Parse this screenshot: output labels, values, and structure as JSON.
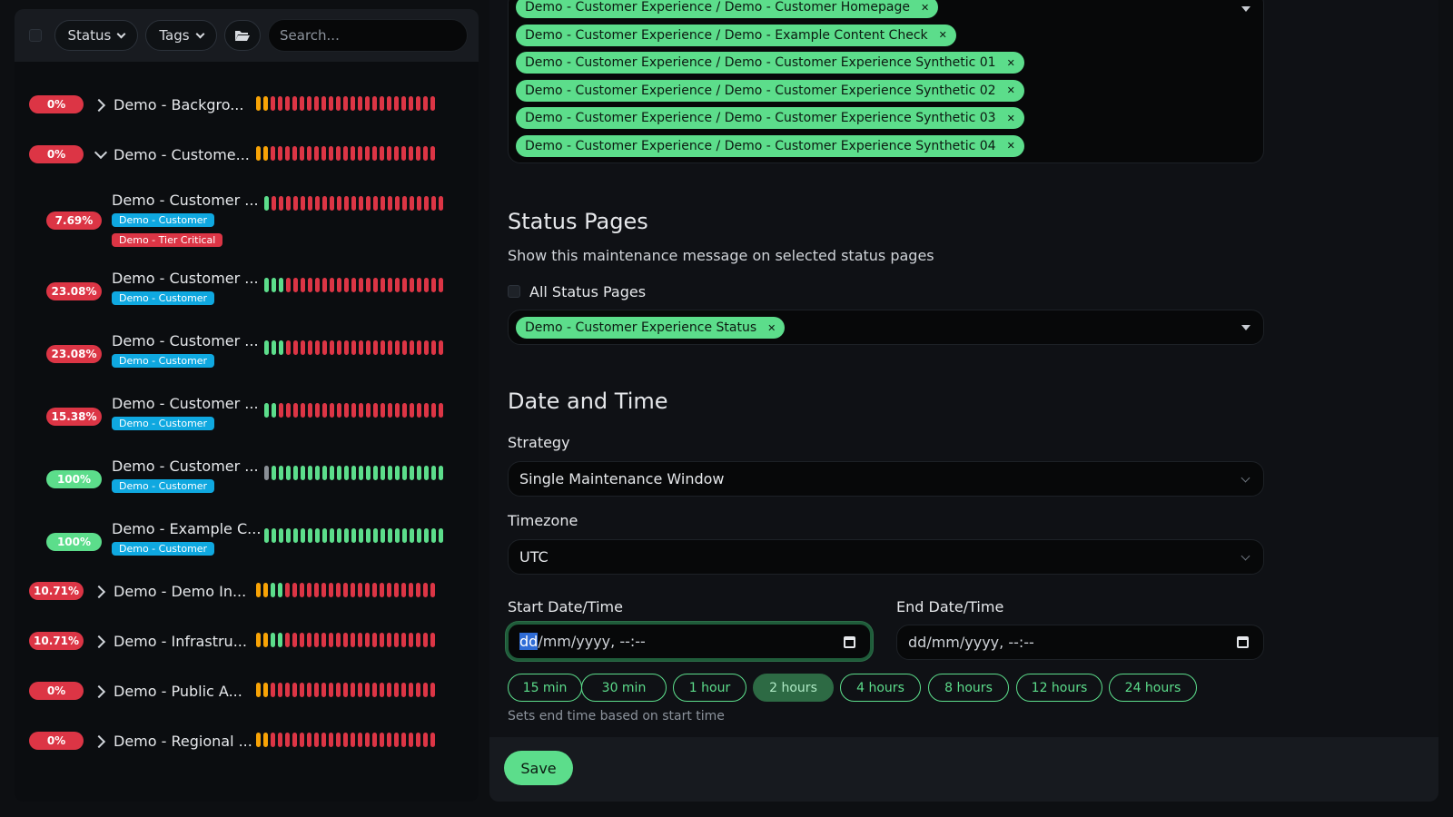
{
  "sidebar": {
    "status_label": "Status",
    "tags_label": "Tags",
    "search_placeholder": "Search...",
    "monitors": [
      {
        "pct": "0%",
        "name": "Demo - Backgro...",
        "status": "red",
        "caret": "right",
        "bars": "yyrrrrrrrrrrrrrrrrrrrrrrr"
      },
      {
        "pct": "0%",
        "name": "Demo - Custome...",
        "status": "red",
        "caret": "down",
        "bars": "yyrrrrrrrrrrrrrrrrrrrrrrr"
      },
      {
        "pct": "7.69%",
        "name": "Demo - Customer ...",
        "status": "red",
        "tags": [
          "Demo - Customer",
          "Demo - Tier Critical"
        ],
        "bars": "grrrrrrrrrrrrrrrrrrrrrrrr"
      },
      {
        "pct": "23.08%",
        "name": "Demo - Customer ...",
        "status": "red",
        "tags": [
          "Demo - Customer"
        ],
        "bars": "gggrrrrrrrrrrrrrrrrrrrrrr"
      },
      {
        "pct": "23.08%",
        "name": "Demo - Customer ...",
        "status": "red",
        "tags": [
          "Demo - Customer"
        ],
        "bars": "gggrrrrrrrrrrrrrrrrrrrrrr"
      },
      {
        "pct": "15.38%",
        "name": "Demo - Customer ...",
        "status": "red",
        "tags": [
          "Demo - Customer"
        ],
        "bars": "ggrrrrrrrrrrrrrrrrrrrrrrr"
      },
      {
        "pct": "100%",
        "name": "Demo - Customer ...",
        "status": "green",
        "tags": [
          "Demo - Customer"
        ],
        "bars": "eggggggggggggggggggggggggg"
      },
      {
        "pct": "100%",
        "name": "Demo - Example C...",
        "status": "green",
        "tags": [
          "Demo - Customer"
        ],
        "bars": "ggggggggggggggggggggggggg"
      },
      {
        "pct": "10.71%",
        "name": "Demo - Demo In...",
        "status": "red",
        "caret": "right",
        "bars": "yyggrrrrrrrrrrrrrrrrrrrrr"
      },
      {
        "pct": "10.71%",
        "name": "Demo - Infrastru...",
        "status": "red",
        "caret": "right",
        "bars": "yyggrrrrrrrrrrrrrrrrrrrrr"
      },
      {
        "pct": "0%",
        "name": "Demo - Public A...",
        "status": "red",
        "caret": "right",
        "bars": "yyrrrrrrrrrrrrrrrrrrrrrrr"
      },
      {
        "pct": "0%",
        "name": "Demo - Regional ...",
        "status": "red",
        "caret": "right",
        "bars": "yyrrrrrrrrrrrrrrrrrrrrrrr"
      }
    ]
  },
  "affected_monitors": [
    "Demo - Customer Experience / Demo - Customer Homepage",
    "Demo - Customer Experience / Demo - Example Content Check",
    "Demo - Customer Experience / Demo - Customer Experience Synthetic 01",
    "Demo - Customer Experience / Demo - Customer Experience Synthetic 02",
    "Demo - Customer Experience / Demo - Customer Experience Synthetic 03",
    "Demo - Customer Experience / Demo - Customer Experience Synthetic 04"
  ],
  "status_pages": {
    "title": "Status Pages",
    "description": "Show this maintenance message on selected status pages",
    "all_label": "All Status Pages",
    "selected": [
      "Demo - Customer Experience Status"
    ]
  },
  "date_time": {
    "title": "Date and Time",
    "strategy_label": "Strategy",
    "strategy_value": "Single Maintenance Window",
    "timezone_label": "Timezone",
    "timezone_value": "UTC",
    "start_label": "Start Date/Time",
    "start_highlight": "dd",
    "start_rest": "/mm/yyyy, --:--",
    "end_label": "End Date/Time",
    "end_value": "dd/mm/yyyy, --:--",
    "quick_buttons": [
      "15 min",
      "30 min",
      "1 hour",
      "2 hours",
      "4 hours",
      "8 hours",
      "12 hours",
      "24 hours"
    ],
    "active_quick": "2 hours",
    "hint": "Sets end time based on start time"
  },
  "save_label": "Save",
  "colors": {
    "accent": "#5cdd8b",
    "danger": "#dc3545",
    "warning": "#f8a306",
    "info": "#0fa8e0"
  }
}
